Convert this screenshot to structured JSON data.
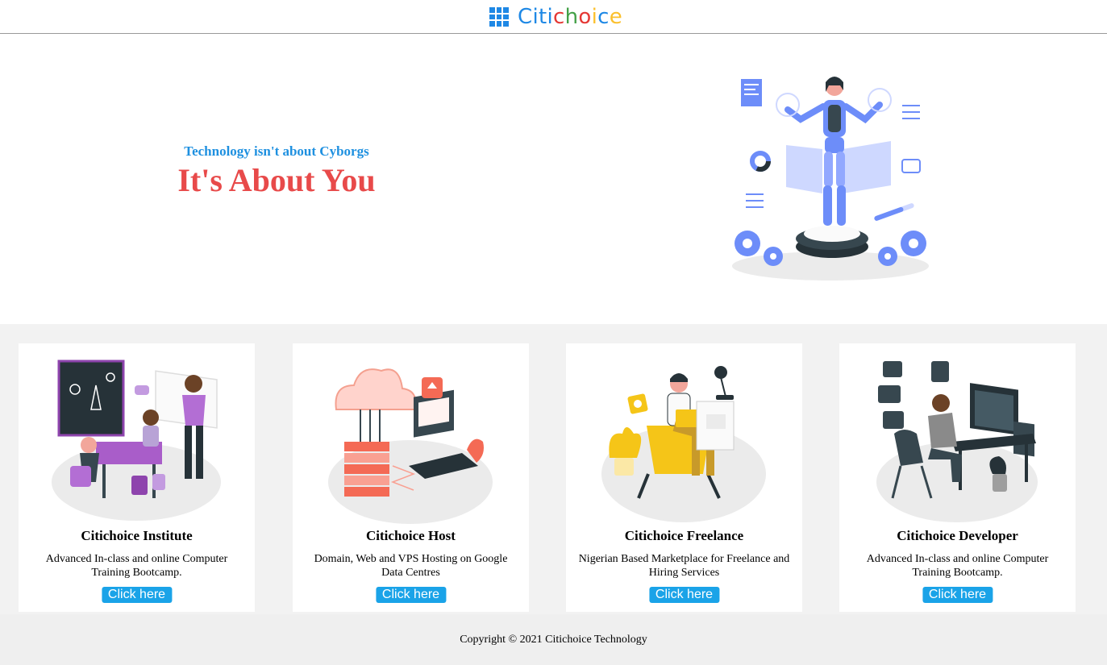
{
  "header": {
    "logo_letters": [
      {
        "ch": "C",
        "color": "#1e88e5"
      },
      {
        "ch": "i",
        "color": "#1e88e5"
      },
      {
        "ch": "t",
        "color": "#1e88e5"
      },
      {
        "ch": "i",
        "color": "#1e88e5"
      },
      {
        "ch": "c",
        "color": "#e53935"
      },
      {
        "ch": "h",
        "color": "#43a047"
      },
      {
        "ch": "o",
        "color": "#e53935"
      },
      {
        "ch": "i",
        "color": "#fbc02d"
      },
      {
        "ch": "c",
        "color": "#1e88e5"
      },
      {
        "ch": "e",
        "color": "#fbc02d"
      }
    ],
    "logo_icon": "grid-icon"
  },
  "hero": {
    "subtitle": "Technology isn't about Cyborgs",
    "title": "It's About You",
    "subtitle_color": "#1e90e0",
    "title_color": "#e84a4a",
    "illustration": "robot-woman-illustration"
  },
  "services": {
    "cards": [
      {
        "title": "Citichoice Institute",
        "description": "Advanced In-class and online Computer Training Bootcamp.",
        "button_label": "Click here",
        "illustration": "classroom-illustration"
      },
      {
        "title": "Citichoice Host",
        "description": "Domain, Web and VPS Hosting on Google Data Centres",
        "button_label": "Click here",
        "illustration": "cloud-hosting-illustration"
      },
      {
        "title": "Citichoice Freelance",
        "description": "Nigerian Based Marketplace for Freelance and Hiring Services",
        "button_label": "Click here",
        "illustration": "freelancer-illustration"
      },
      {
        "title": "Citichoice Developer",
        "description": "Advanced In-class and online Computer Training Bootcamp.",
        "button_label": "Click here",
        "illustration": "developer-illustration"
      }
    ],
    "button_color": "#1aa3e8"
  },
  "footer": {
    "copyright": "Copyright © 2021 Citichoice Technology"
  }
}
